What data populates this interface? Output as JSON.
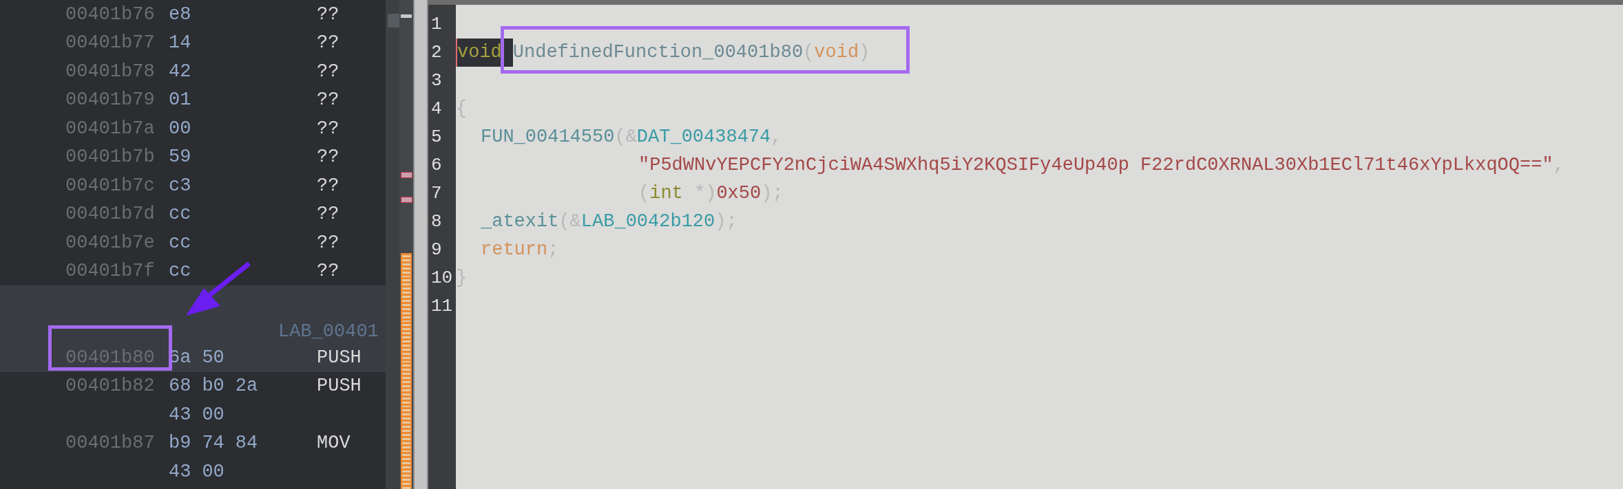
{
  "listing": {
    "rows": [
      {
        "kind": "data",
        "address": "00401b76",
        "bytes": [
          "e8"
        ],
        "mnemonic": "??",
        "selected": false
      },
      {
        "kind": "data",
        "address": "00401b77",
        "bytes": [
          "14"
        ],
        "mnemonic": "??",
        "selected": false
      },
      {
        "kind": "data",
        "address": "00401b78",
        "bytes": [
          "42"
        ],
        "mnemonic": "??",
        "selected": false
      },
      {
        "kind": "data",
        "address": "00401b79",
        "bytes": [
          "01"
        ],
        "mnemonic": "??",
        "selected": false
      },
      {
        "kind": "data",
        "address": "00401b7a",
        "bytes": [
          "00"
        ],
        "mnemonic": "??",
        "selected": false
      },
      {
        "kind": "data",
        "address": "00401b7b",
        "bytes": [
          "59"
        ],
        "mnemonic": "??",
        "selected": false
      },
      {
        "kind": "data",
        "address": "00401b7c",
        "bytes": [
          "c3"
        ],
        "mnemonic": "??",
        "selected": false
      },
      {
        "kind": "data",
        "address": "00401b7d",
        "bytes": [
          "cc"
        ],
        "mnemonic": "??",
        "selected": false
      },
      {
        "kind": "data",
        "address": "00401b7e",
        "bytes": [
          "cc"
        ],
        "mnemonic": "??",
        "selected": false
      },
      {
        "kind": "data",
        "address": "00401b7f",
        "bytes": [
          "cc"
        ],
        "mnemonic": "??",
        "selected": false
      },
      {
        "kind": "label",
        "label": "LAB_00401",
        "selected": true
      },
      {
        "kind": "instr",
        "address": "00401b80",
        "bytes": [
          "6a",
          "50"
        ],
        "mnemonic": "PUSH",
        "selected": true
      },
      {
        "kind": "instr",
        "address": "00401b82",
        "bytes": [
          "68",
          "b0",
          "2a"
        ],
        "mnemonic": "PUSH",
        "selected": false
      },
      {
        "kind": "cont",
        "bytes": [
          "43",
          "00"
        ],
        "selected": false
      },
      {
        "kind": "instr",
        "address": "00401b87",
        "bytes": [
          "b9",
          "74",
          "84"
        ],
        "mnemonic": "MOV",
        "selected": false
      },
      {
        "kind": "cont",
        "bytes": [
          "43",
          "00"
        ],
        "selected": false
      }
    ]
  },
  "decompiler": {
    "lines": [
      {
        "number": "1",
        "kind": "top"
      },
      {
        "number": "2",
        "kind": "top",
        "tokens": [
          {
            "kind": "cursor",
            "text": "void"
          },
          {
            "kind": "funcname",
            "text": "UndefinedFunction_00401b80"
          },
          {
            "kind": "punct",
            "text": "("
          },
          {
            "kind": "keyword",
            "text": "void"
          },
          {
            "kind": "punct",
            "text": ")"
          }
        ]
      },
      {
        "number": "3",
        "kind": "top"
      },
      {
        "number": "4",
        "kind": "top",
        "tokens": [
          {
            "kind": "punct",
            "text": "{"
          }
        ]
      },
      {
        "number": "5",
        "kind": "body",
        "tokens": [
          {
            "kind": "call",
            "text": "FUN_00414550"
          },
          {
            "kind": "punct",
            "text": "(&"
          },
          {
            "kind": "data",
            "text": "DAT_00438474"
          },
          {
            "kind": "punct",
            "text": ","
          }
        ]
      },
      {
        "number": "6",
        "kind": "cont",
        "tokens": [
          {
            "kind": "string",
            "text": "\"P5dWNvYEPCFY2nCjciWA4SWXhq5iY2KQSIFy4eUp40p F22rdC0XRNAL30Xb1ECl71t46xYpLkxqOQ==\""
          },
          {
            "kind": "punct",
            "text": ","
          }
        ]
      },
      {
        "number": "7",
        "kind": "cont",
        "tokens": [
          {
            "kind": "punct",
            "text": "("
          },
          {
            "kind": "type",
            "text": "int"
          },
          {
            "kind": "punct",
            "text": " *)"
          },
          {
            "kind": "number",
            "text": "0x50"
          },
          {
            "kind": "punct",
            "text": ");"
          }
        ]
      },
      {
        "number": "8",
        "kind": "body",
        "tokens": [
          {
            "kind": "call",
            "text": "_atexit"
          },
          {
            "kind": "punct",
            "text": "(&"
          },
          {
            "kind": "data",
            "text": "LAB_0042b120"
          },
          {
            "kind": "punct",
            "text": ");"
          }
        ]
      },
      {
        "number": "9",
        "kind": "body",
        "tokens": [
          {
            "kind": "keyword",
            "text": "return"
          },
          {
            "kind": "punct",
            "text": ";"
          }
        ]
      },
      {
        "number": "10",
        "kind": "top",
        "tokens": [
          {
            "kind": "punct",
            "text": "}"
          }
        ]
      },
      {
        "number": "11",
        "kind": "top"
      }
    ]
  }
}
